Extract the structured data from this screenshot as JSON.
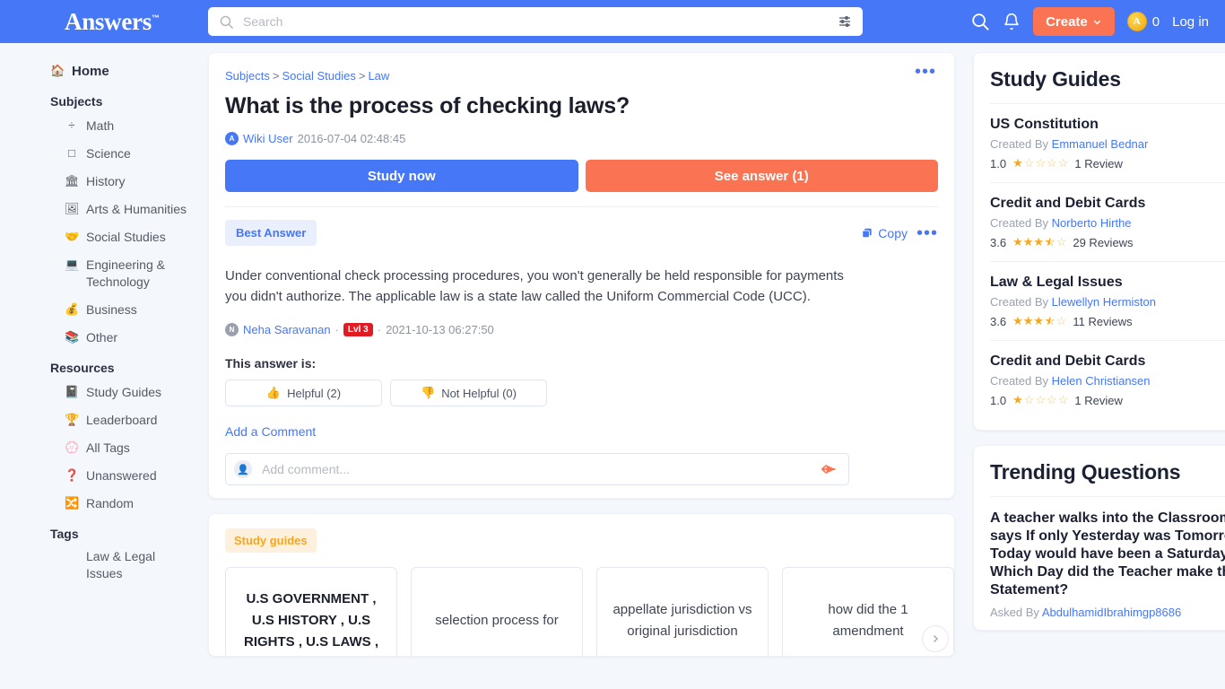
{
  "header": {
    "logo": "Answers",
    "logo_tm": "™",
    "search_placeholder": "Search",
    "search_value": "",
    "search_icon": "search-icon",
    "filter_icon": "filter-sliders-icon",
    "magnify_icon": "search-icon",
    "bell_icon": "notification-bell-icon",
    "create_label": "Create",
    "create_caret": "⌄",
    "coin_letter": "A",
    "coin_count": "0",
    "login_label": "Log in"
  },
  "sidebar": {
    "home": {
      "label": "Home",
      "icon": "home-icon",
      "glyph": "🏠"
    },
    "subjects_heading": "Subjects",
    "subjects": [
      {
        "label": "Math",
        "icon": "division-sign-icon",
        "glyph": "÷"
      },
      {
        "label": "Science",
        "icon": "flask-icon",
        "glyph": "□"
      },
      {
        "label": "History",
        "icon": "bank-building-icon",
        "glyph": "🏛"
      },
      {
        "label": "Arts & Humanities",
        "icon": "art-icon",
        "glyph": "🖼"
      },
      {
        "label": "Social Studies",
        "icon": "handshake-icon",
        "glyph": "🤝"
      },
      {
        "label": "Engineering & Technology",
        "icon": "laptop-icon",
        "glyph": "💻"
      },
      {
        "label": "Business",
        "icon": "money-bag-icon",
        "glyph": "💰"
      },
      {
        "label": "Other",
        "icon": "books-icon",
        "glyph": "📚"
      }
    ],
    "resources_heading": "Resources",
    "resources": [
      {
        "label": "Study Guides",
        "icon": "book-icon",
        "glyph": "📓"
      },
      {
        "label": "Leaderboard",
        "icon": "trophy-icon",
        "glyph": "🏆"
      },
      {
        "label": "All Tags",
        "icon": "tags-icon",
        "glyph": "💮"
      },
      {
        "label": "Unanswered",
        "icon": "question-mark-icon",
        "glyph": "❓"
      },
      {
        "label": "Random",
        "icon": "shuffle-icon",
        "glyph": "🔀"
      }
    ],
    "tags_heading": "Tags",
    "tags": [
      {
        "label": "Law & Legal Issues"
      }
    ]
  },
  "question": {
    "breadcrumb": [
      "Subjects",
      "Social Studies",
      "Law"
    ],
    "breadcrumb_sep": ">",
    "menu_dots": "•••",
    "title": "What is the process of checking laws?",
    "author_initial": "A",
    "author": "Wiki User",
    "date": "2016-07-04 02:48:45",
    "study_now_label": "Study now",
    "see_answer_label": "See answer (1)"
  },
  "answer": {
    "best_badge": "Best Answer",
    "copy_label": "Copy",
    "copy_icon": "copy-icon",
    "menu_dots": "•••",
    "text": "Under conventional check processing procedures, you won't generally be held responsible for payments you didn't authorize. The applicable law is a state law called the Uniform Commercial Code (UCC).",
    "author_initial": "N",
    "author": "Neha Saravanan",
    "separator": "·",
    "level_badge": "Lvl 3",
    "date": "2021-10-13 06:27:50",
    "this_answer_is": "This answer is:",
    "helpful_label": "Helpful (2)",
    "helpful_icon": "thumbs-up-icon",
    "helpful_glyph": "👍",
    "not_helpful_label": "Not Helpful (0)",
    "not_helpful_icon": "thumbs-down-icon",
    "not_helpful_glyph": "👎",
    "add_comment_link": "Add a Comment",
    "comment_placeholder": "Add comment...",
    "comment_value": "",
    "comment_avatar_glyph": "👤",
    "send_icon": "send-arrow-icon"
  },
  "study_guides_carousel": {
    "tag": "Study guides",
    "next_icon": "chevron-right-icon",
    "items": [
      {
        "label": "U.S GOVERNMENT , U.S HISTORY , U.S RIGHTS , U.S LAWS ,",
        "bold": true
      },
      {
        "label": "selection process for",
        "bold": false
      },
      {
        "label": "appellate jurisdiction vs original jurisdiction",
        "bold": false
      },
      {
        "label": "how did the 1 amendment",
        "bold": false
      }
    ]
  },
  "right_panel": {
    "study_guides": {
      "title": "Study Guides",
      "created_by_label": "Created By",
      "items": [
        {
          "title": "US Constitution",
          "author": "Emmanuel Bednar",
          "score": "1.0",
          "stars": 1.0,
          "reviews": "1 Review"
        },
        {
          "title": "Credit and Debit Cards",
          "author": "Norberto Hirthe",
          "score": "3.6",
          "stars": 3.6,
          "reviews": "29 Reviews"
        },
        {
          "title": "Law & Legal Issues",
          "author": "Llewellyn Hermiston",
          "score": "3.6",
          "stars": 3.6,
          "reviews": "11 Reviews"
        },
        {
          "title": "Credit and Debit Cards",
          "author": "Helen Christiansen",
          "score": "1.0",
          "stars": 1.0,
          "reviews": "1 Review"
        }
      ]
    },
    "trending": {
      "title": "Trending Questions",
      "asked_by_label": "Asked By",
      "items": [
        {
          "question": "A teacher walks into the Classroom and says If only Yesterday was Tomorrow Today would have been a Saturday Which Day did the Teacher make this Statement?",
          "author": "AbdulhamidIbrahimgp8686"
        }
      ]
    }
  },
  "colors": {
    "brand_blue": "#4577f6",
    "accent_orange": "#fa7352",
    "page_bg": "#f4f7fc",
    "star_gold": "#f5a623",
    "level_red": "#e01b24"
  }
}
